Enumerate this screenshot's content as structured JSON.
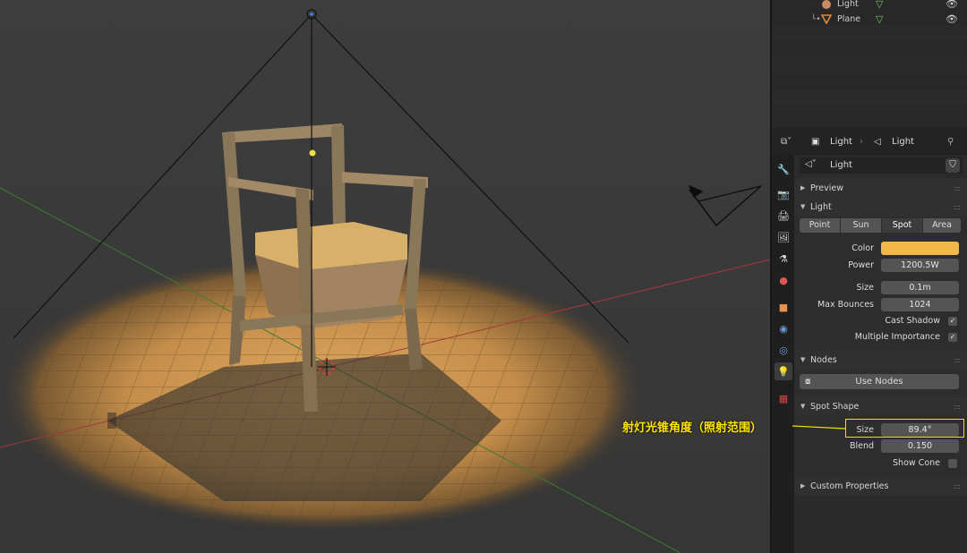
{
  "outliner": {
    "items": [
      {
        "name": "Light",
        "eye": "👁"
      },
      {
        "name": "Plane",
        "eye": "👁"
      }
    ]
  },
  "header": {
    "breadcrumb_object": "Light",
    "breadcrumb_data": "Light",
    "datablock_name": "Light"
  },
  "sections": {
    "preview": "Preview",
    "light": "Light",
    "nodes": "Nodes",
    "spot_shape": "Spot Shape",
    "custom_properties": "Custom Properties"
  },
  "light": {
    "types": [
      "Point",
      "Sun",
      "Spot",
      "Area"
    ],
    "selected_type": "Spot",
    "color_label": "Color",
    "color_value": "#f2b84a",
    "power_label": "Power",
    "power_value": "1200.5W",
    "size_label": "Size",
    "size_value": "0.1m",
    "max_bounces_label": "Max Bounces",
    "max_bounces_value": "1024",
    "cast_shadow_label": "Cast Shadow",
    "cast_shadow_check": "✓",
    "multiple_importance_label": "Multiple Importance",
    "multiple_importance_check": "✓"
  },
  "nodes": {
    "use_nodes_label": "Use Nodes"
  },
  "spot_shape": {
    "size_label": "Size",
    "size_value": "89.4°",
    "blend_label": "Blend",
    "blend_value": "0.150",
    "show_cone_label": "Show Cone"
  },
  "annotation": {
    "text": "射灯光锥角度（照射范围）"
  },
  "colors": {
    "accent_active": "#4772b3",
    "spotlight": "#d9a35a",
    "annotation": "#ffe600"
  }
}
